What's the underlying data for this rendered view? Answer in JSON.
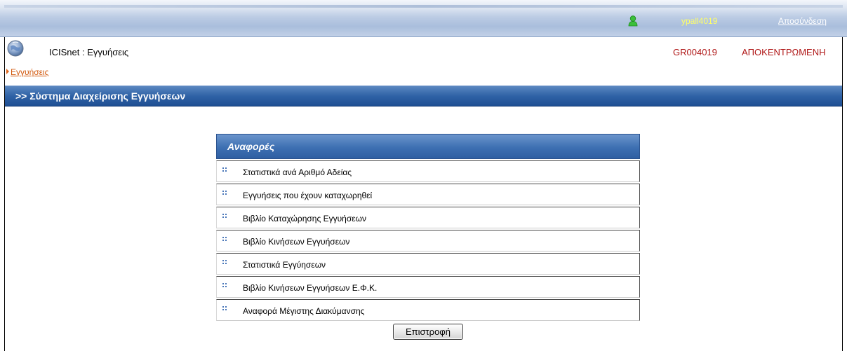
{
  "topbar": {
    "username": "ypall4019",
    "logout_label": "Αποσύνδεση",
    "user_icon": "user-icon"
  },
  "header": {
    "logo_icon": "globe-icon",
    "app_title": "ICISnet : Εγγυήσεις",
    "breadcrumb": "Εγγυήσεις",
    "customs_code": "GR004019",
    "customs_name": "ΑΠΟΚΕΝΤΡΩΜΕΝΗ"
  },
  "section": {
    "title": ">> Σύστημα Διαχείρισης Εγγυήσεων"
  },
  "reports": {
    "title": "Αναφορές",
    "items": [
      "Στατιστικά ανά Αριθμό Αδείας",
      "Εγγυήσεις που έχουν καταχωρηθεί",
      "Βιβλίο Καταχώρησης Εγγυήσεων",
      "Βιβλίο Κινήσεων Εγγυήσεων",
      "Στατιστικά Εγγύησεων",
      "Βιβλίο Κινήσεων Εγγυήσεων Ε.Φ.Κ.",
      "Αναφορά Μέγιστης Διακύμανσης"
    ]
  },
  "buttons": {
    "back_label": "Επιστροφή"
  },
  "colors": {
    "accent_blue": "#2f62a6",
    "customs_red": "#b01818",
    "username_yellow": "#ffff66",
    "breadcrumb_orange": "#d25a10"
  }
}
